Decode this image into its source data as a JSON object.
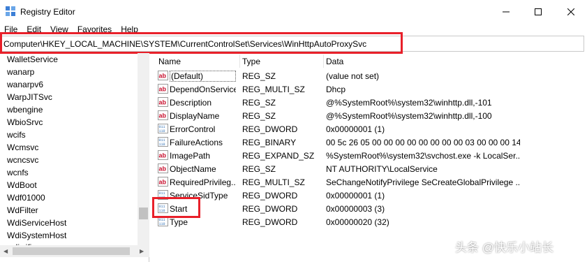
{
  "window": {
    "title": "Registry Editor",
    "icons": {
      "app": "registry-editor-icon",
      "minimize": "minimize-icon",
      "maximize": "maximize-icon",
      "close": "close-icon"
    }
  },
  "menu": [
    "File",
    "Edit",
    "View",
    "Favorites",
    "Help"
  ],
  "address": "Computer\\HKEY_LOCAL_MACHINE\\SYSTEM\\CurrentControlSet\\Services\\WinHttpAutoProxySvc",
  "tree": [
    "WalletService",
    "wanarp",
    "wanarpv6",
    "WarpJITSvc",
    "wbengine",
    "WbioSrvc",
    "wcifs",
    "Wcmsvc",
    "wcncsvc",
    "wcnfs",
    "WdBoot",
    "Wdf01000",
    "WdFilter",
    "WdiServiceHost",
    "WdiSystemHost",
    "wdiwifi"
  ],
  "columns": {
    "name": "Name",
    "type": "Type",
    "data": "Data"
  },
  "values": [
    {
      "name": "(Default)",
      "type": "REG_SZ",
      "data": "(value not set)",
      "icon": "string-value-icon"
    },
    {
      "name": "DependOnService",
      "type": "REG_MULTI_SZ",
      "data": "Dhcp",
      "icon": "string-value-icon"
    },
    {
      "name": "Description",
      "type": "REG_SZ",
      "data": "@%SystemRoot%\\system32\\winhttp.dll,-101",
      "icon": "string-value-icon"
    },
    {
      "name": "DisplayName",
      "type": "REG_SZ",
      "data": "@%SystemRoot%\\system32\\winhttp.dll,-100",
      "icon": "string-value-icon"
    },
    {
      "name": "ErrorControl",
      "type": "REG_DWORD",
      "data": "0x00000001 (1)",
      "icon": "binary-value-icon"
    },
    {
      "name": "FailureActions",
      "type": "REG_BINARY",
      "data": "00 5c 26 05 00 00 00 00 00 00 00 00 03 00 00 00 14 00...",
      "icon": "binary-value-icon"
    },
    {
      "name": "ImagePath",
      "type": "REG_EXPAND_SZ",
      "data": "%SystemRoot%\\system32\\svchost.exe -k LocalSer...",
      "icon": "string-value-icon"
    },
    {
      "name": "ObjectName",
      "type": "REG_SZ",
      "data": "NT AUTHORITY\\LocalService",
      "icon": "string-value-icon"
    },
    {
      "name": "RequiredPrivileg...",
      "type": "REG_MULTI_SZ",
      "data": "SeChangeNotifyPrivilege SeCreateGlobalPrivilege ...",
      "icon": "string-value-icon"
    },
    {
      "name": "ServiceSidType",
      "type": "REG_DWORD",
      "data": "0x00000001 (1)",
      "icon": "binary-value-icon"
    },
    {
      "name": "Start",
      "type": "REG_DWORD",
      "data": "0x00000003 (3)",
      "icon": "binary-value-icon"
    },
    {
      "name": "Type",
      "type": "REG_DWORD",
      "data": "0x00000020 (32)",
      "icon": "binary-value-icon"
    }
  ],
  "watermark": "头条 @快乐小站长",
  "colors": {
    "highlight": "#e8202a",
    "string_icon": "#c8102e",
    "binary_icon": "#2f6fb5"
  }
}
